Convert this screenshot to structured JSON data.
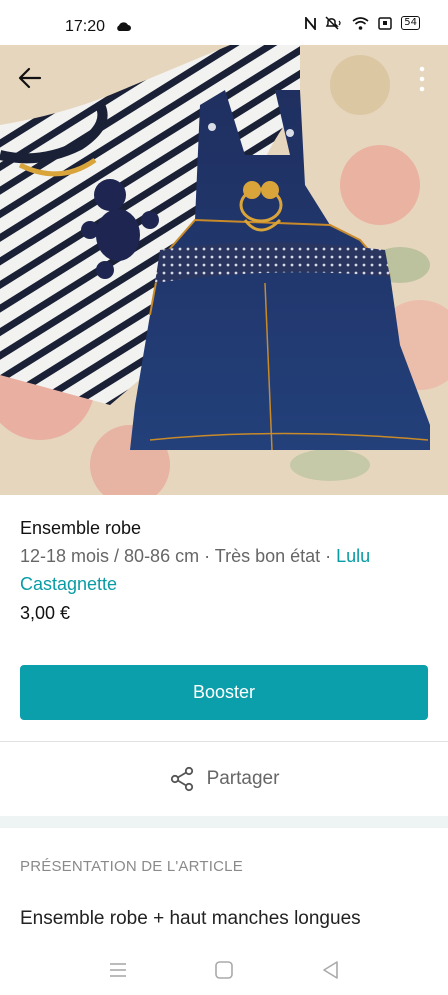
{
  "status_bar": {
    "time": "17:20",
    "battery": "54",
    "icons": [
      "cloud-icon",
      "nfc-icon",
      "mute-icon",
      "wifi-icon",
      "sim-icon",
      "battery-icon"
    ]
  },
  "header": {
    "back_icon": "arrow-left-icon",
    "menu_icon": "more-vertical-icon"
  },
  "item": {
    "title": "Ensemble robe",
    "size": "12-18 mois / 80-86 cm",
    "sep1": " · ",
    "condition": "Très bon état",
    "sep2": " · ",
    "brand": "Lulu Castagnette",
    "price": "3,00 €"
  },
  "actions": {
    "booster_label": "Booster",
    "share_label": "Partager"
  },
  "description_section": {
    "heading": "PRÉSENTATION DE L'ARTICLE",
    "text": "Ensemble robe + haut manches longues"
  },
  "colors": {
    "accent": "#0b9fab",
    "brand_link": "#0a9ca5"
  }
}
